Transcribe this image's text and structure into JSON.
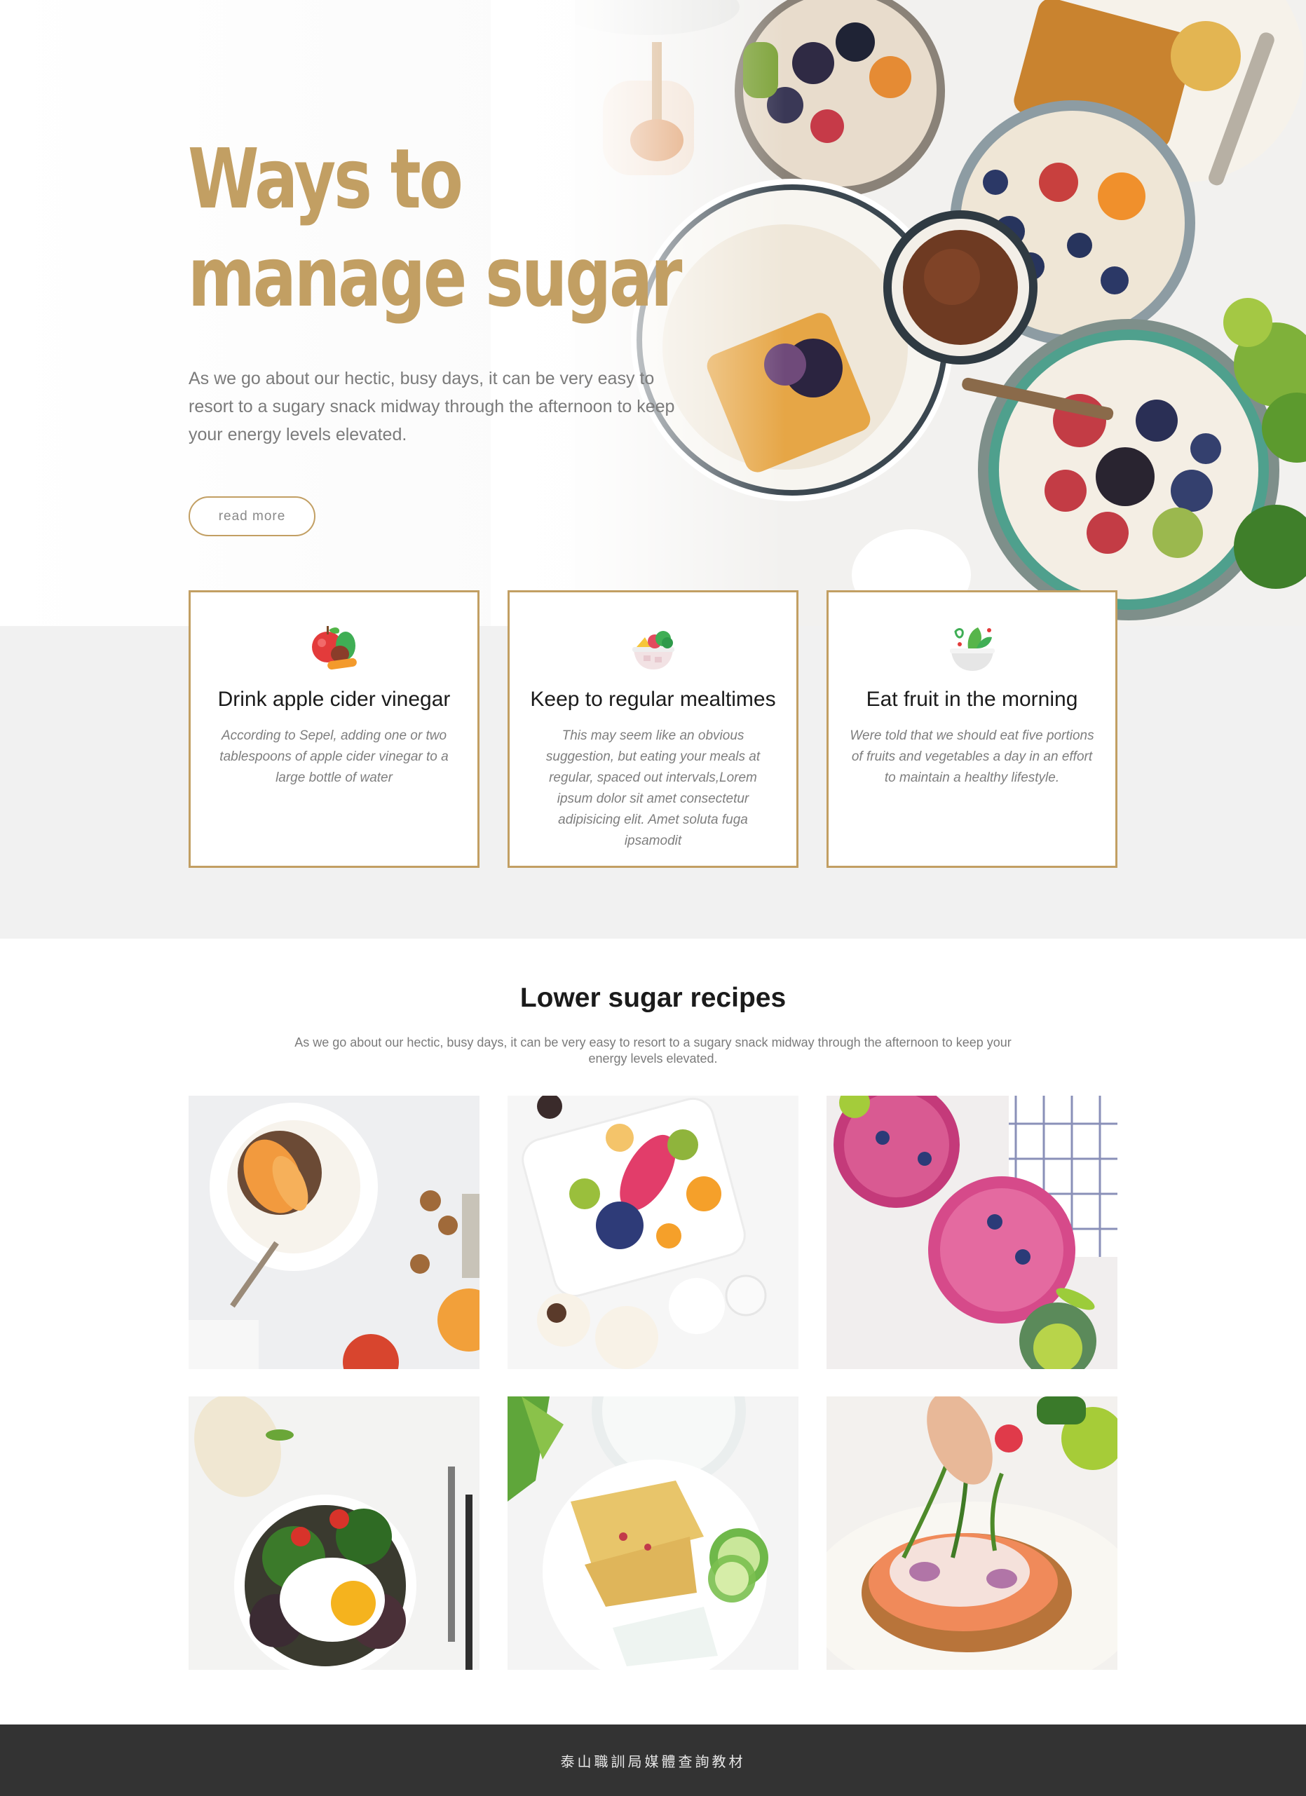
{
  "hero": {
    "title_line1": "Ways to",
    "title_line2": "manage sugar",
    "description": "As we go about our hectic, busy days, it can be very easy to resort to a sugary snack midway through the afternoon to keep your energy levels elevated.",
    "button_label": "read more"
  },
  "features": [
    {
      "icon": "apple-fruit-icon",
      "title": "Drink apple cider vinegar",
      "text": "According to Sepel, adding one or two tablespoons of apple cider vinegar to a large bottle of water"
    },
    {
      "icon": "food-bowl-icon",
      "title": "Keep to regular mealtimes",
      "text": "This may seem like an obvious suggestion, but eating your meals at regular, spaced out intervals,Lorem ipsum dolor sit amet consectetur adipisicing elit. Amet soluta fuga ipsamodit"
    },
    {
      "icon": "salad-bowl-icon",
      "title": "Eat fruit in the morning",
      "text": "Were told that we should eat five portions of fruits and vegetables a day in an effort to maintain a healthy lifestyle."
    }
  ],
  "recipes": {
    "title": "Lower sugar recipes",
    "description": "As we go about our hectic, busy days, it can be very easy to resort to a sugary snack midway through the afternoon to keep your energy levels elevated."
  },
  "footer": {
    "text": "泰山職訓局媒體查詢教材"
  },
  "colors": {
    "accent": "#c29f63",
    "gray_band": "#f1f1f1",
    "footer_bg": "#333333"
  }
}
